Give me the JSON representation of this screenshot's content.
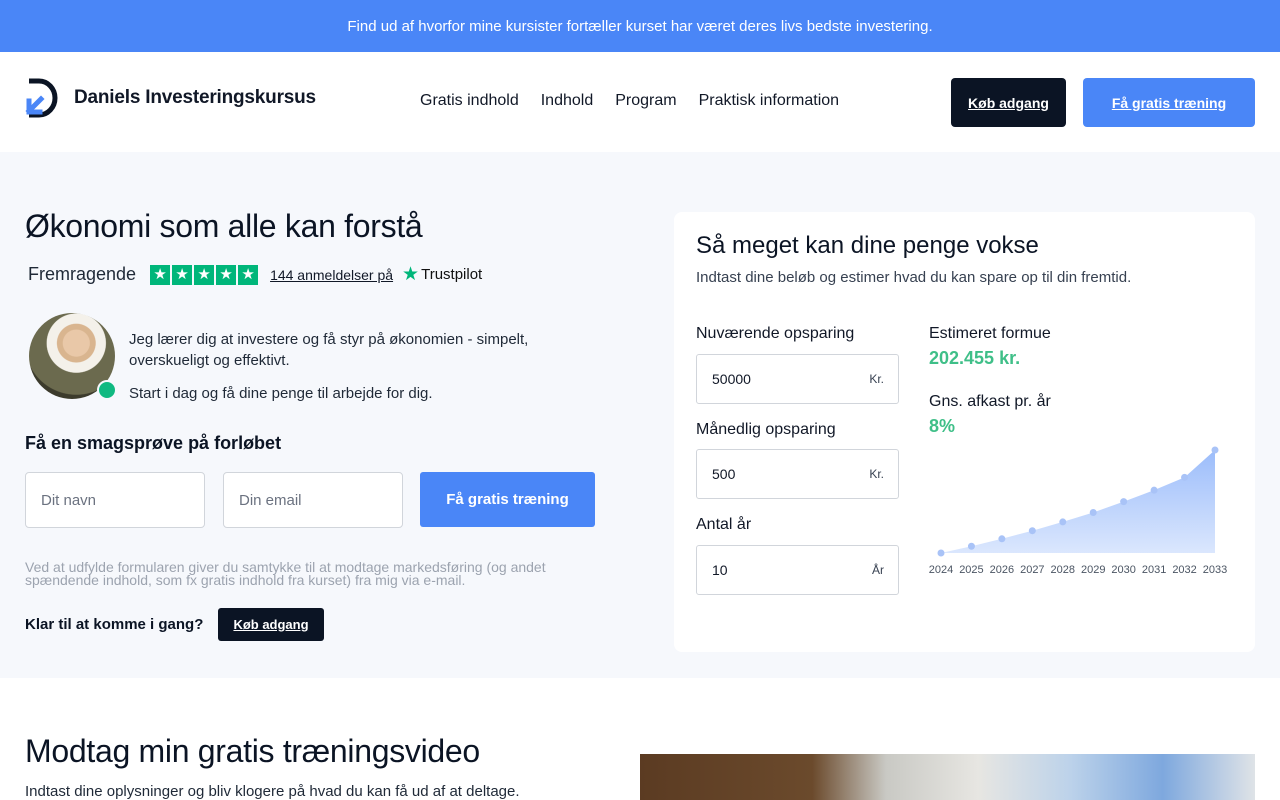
{
  "topbar": {
    "text": "Find ud af hvorfor mine kursister fortæller kurset har været deres livs bedste investering."
  },
  "header": {
    "logo_text": "Daniels Investeringskursus",
    "nav": [
      "Gratis indhold",
      "Indhold",
      "Program",
      "Praktisk information"
    ],
    "buy_label": "Køb adgang",
    "free_label": "Få gratis træning"
  },
  "hero": {
    "title": "Økonomi som alle kan forstå",
    "rating_label": "Fremragende",
    "reviews": "144 anmeldelser på",
    "trustpilot": "Trustpilot",
    "intro1": "Jeg lærer dig at investere og få styr på økonomien - simpelt, overskueligt og effektivt.",
    "intro2": "Start i dag og få dine penge til arbejde for dig.",
    "form_title": "Få en smagsprøve på forløbet",
    "name_placeholder": "Dit navn",
    "email_placeholder": "Din email",
    "submit_label": "Få gratis træning",
    "consent": "Ved at udfylde formularen giver du samtykke til at modtage markedsføring (og andet spændende indhold, som fx gratis indhold fra kurset) fra mig via e-mail.",
    "ready": "Klar til at komme i gang?",
    "buy_small": "Køb adgang"
  },
  "calculator": {
    "title": "Så meget kan dine penge vokse",
    "subtitle": "Indtast dine beløb og estimer hvad du kan spare op til din fremtid.",
    "current_label": "Nuværende opsparing",
    "current_value": "50000",
    "current_unit": "Kr.",
    "monthly_label": "Månedlig opsparing",
    "monthly_value": "500",
    "monthly_unit": "Kr.",
    "years_label": "Antal år",
    "years_value": "10",
    "years_unit": "År",
    "estimate_label": "Estimeret formue",
    "estimate_value": "202.455 kr.",
    "return_label": "Gns. afkast pr. år",
    "return_value": "8%"
  },
  "chart_data": {
    "type": "area",
    "x": [
      "2024",
      "2025",
      "2026",
      "2027",
      "2028",
      "2029",
      "2030",
      "2031",
      "2032",
      "2033"
    ],
    "values": [
      50000,
      60000,
      71000,
      83000,
      96000,
      110000,
      126000,
      143000,
      162000,
      202455
    ],
    "color": "#4a86f7"
  },
  "section2": {
    "title": "Modtag min gratis træningsvideo",
    "subtitle": "Indtast dine oplysninger og bliv klogere på hvad du kan få ud af at deltage."
  },
  "colors": {
    "accent": "#4a86f7",
    "dark": "#0b1424",
    "green": "#3fbf88",
    "trustpilot": "#00b67a"
  }
}
